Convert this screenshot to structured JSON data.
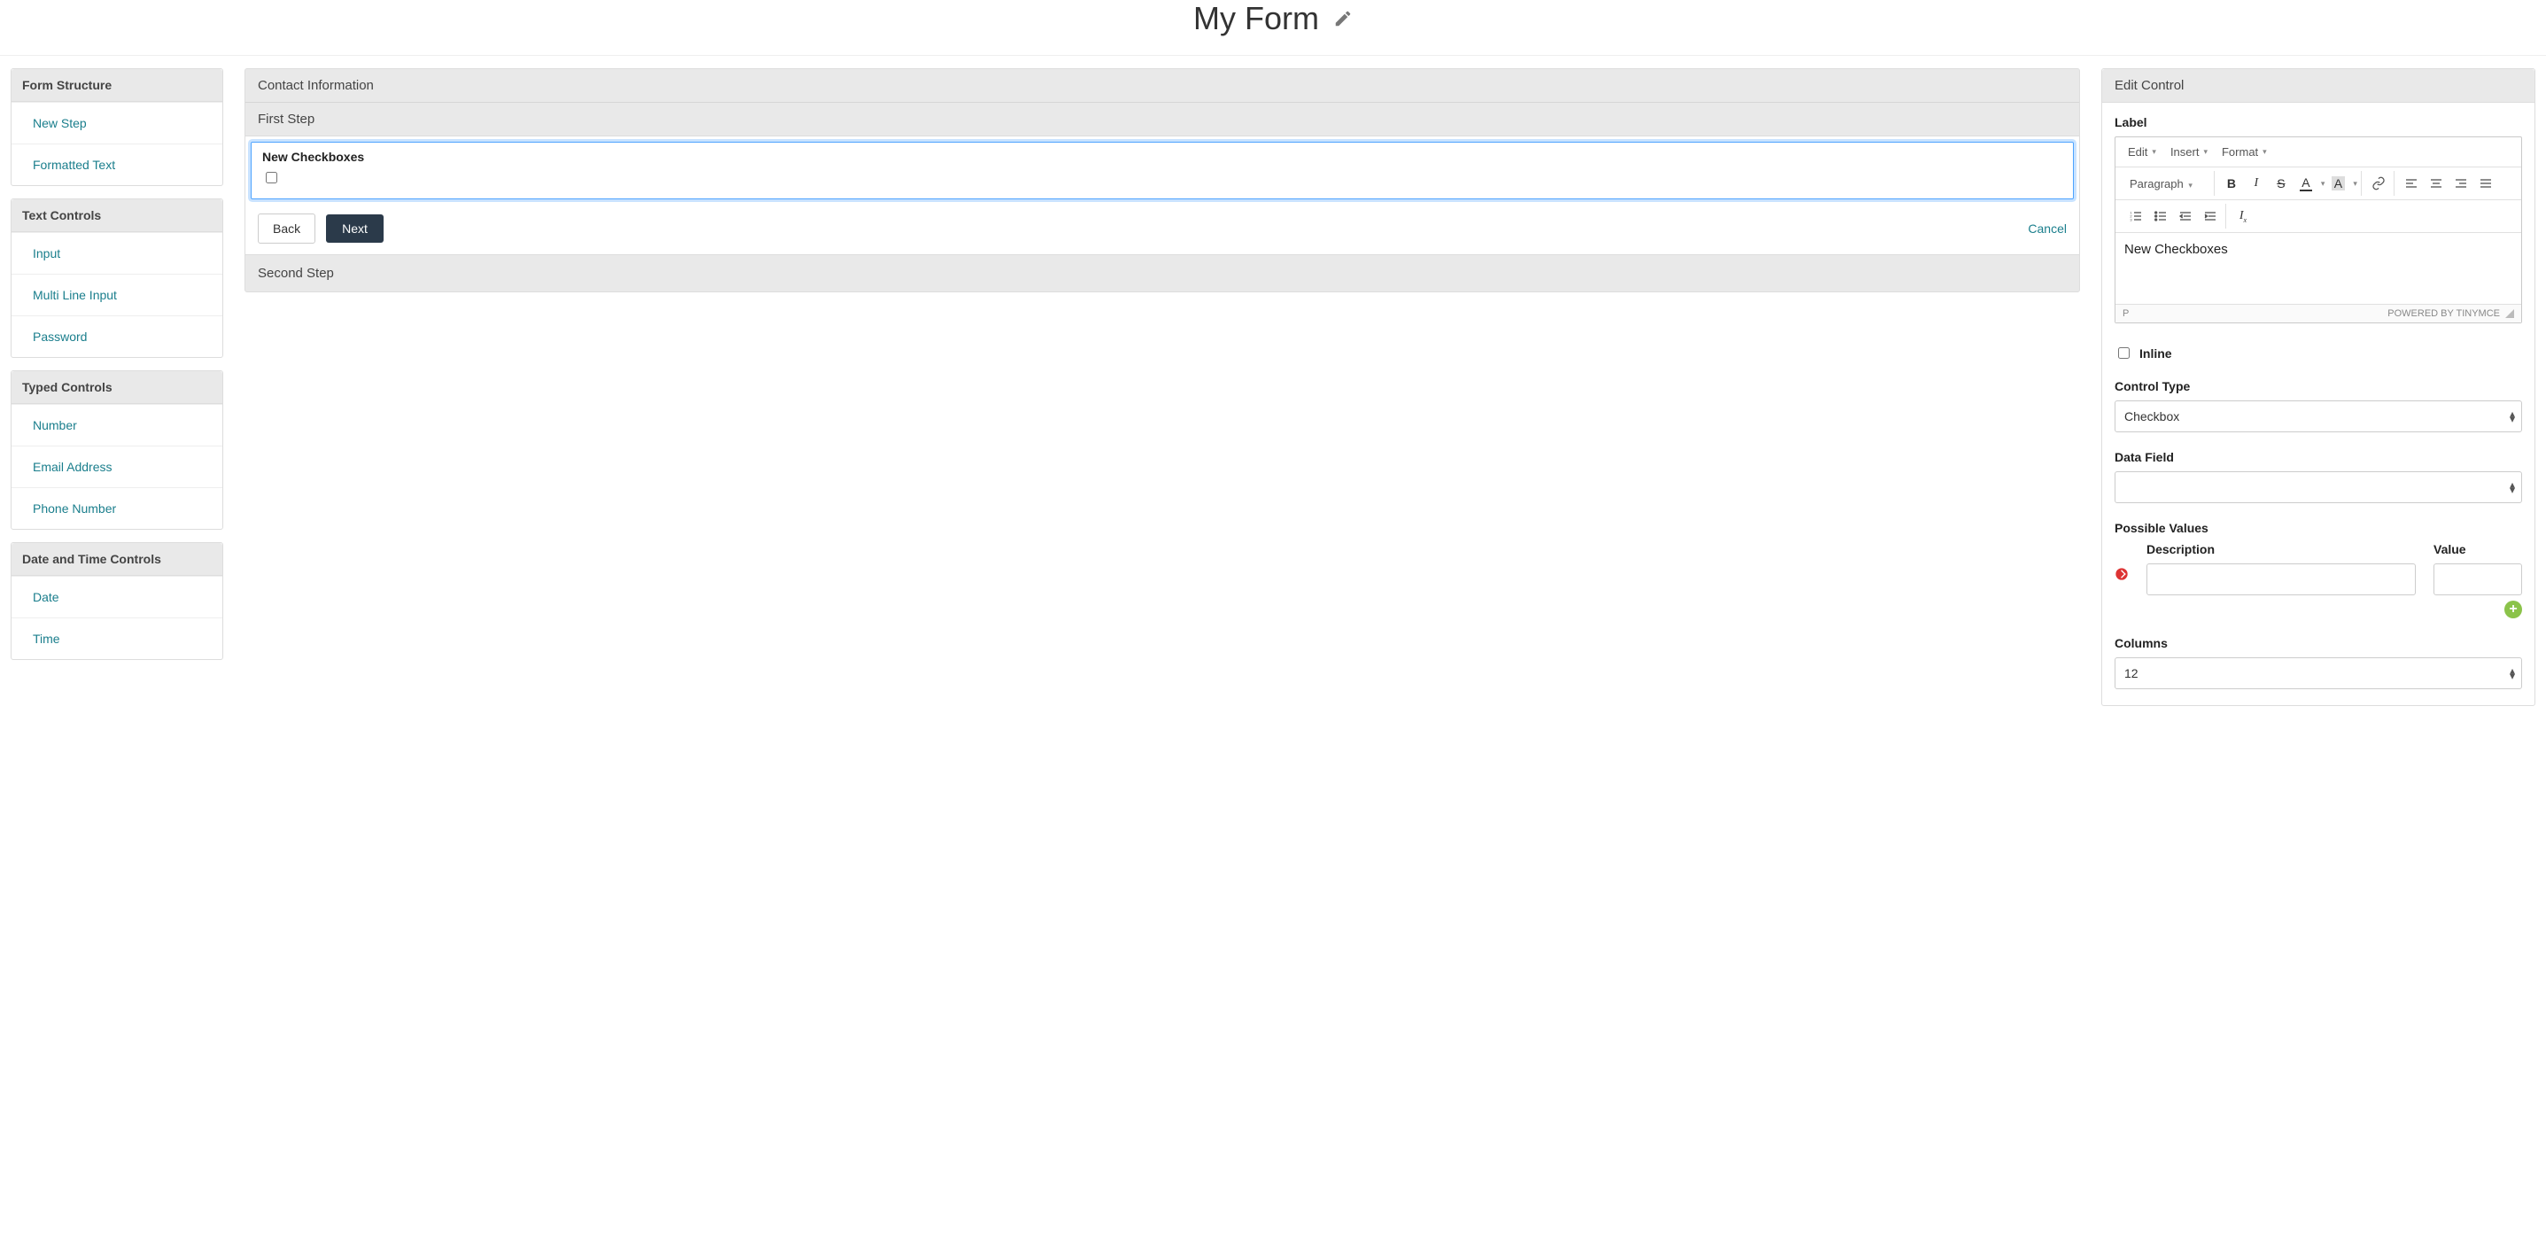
{
  "header": {
    "title": "My Form"
  },
  "sidebar": {
    "groups": [
      {
        "title": "Form Structure",
        "items": [
          "New Step",
          "Formatted Text"
        ]
      },
      {
        "title": "Text Controls",
        "items": [
          "Input",
          "Multi Line Input",
          "Password"
        ]
      },
      {
        "title": "Typed Controls",
        "items": [
          "Number",
          "Email Address",
          "Phone Number"
        ]
      },
      {
        "title": "Date and Time Controls",
        "items": [
          "Date",
          "Time"
        ]
      }
    ]
  },
  "form": {
    "title": "Contact Information",
    "step1": {
      "title": "First Step",
      "control_label": "New Checkboxes",
      "back": "Back",
      "next": "Next",
      "cancel": "Cancel"
    },
    "step2": {
      "title": "Second Step"
    }
  },
  "editor": {
    "title": "Edit Control",
    "label_section": "Label",
    "rte": {
      "menus": [
        "Edit",
        "Insert",
        "Format"
      ],
      "paragraph": "Paragraph",
      "content": "New Checkboxes",
      "path": "P",
      "powered": "POWERED BY TINYMCE"
    },
    "inline_label": "Inline",
    "control_type": {
      "label": "Control Type",
      "value": "Checkbox"
    },
    "data_field": {
      "label": "Data Field",
      "value": ""
    },
    "possible_values": {
      "label": "Possible Values",
      "col_description": "Description",
      "col_value": "Value",
      "rows": [
        {
          "description": "",
          "value": ""
        }
      ]
    },
    "columns": {
      "label": "Columns",
      "value": "12"
    }
  }
}
